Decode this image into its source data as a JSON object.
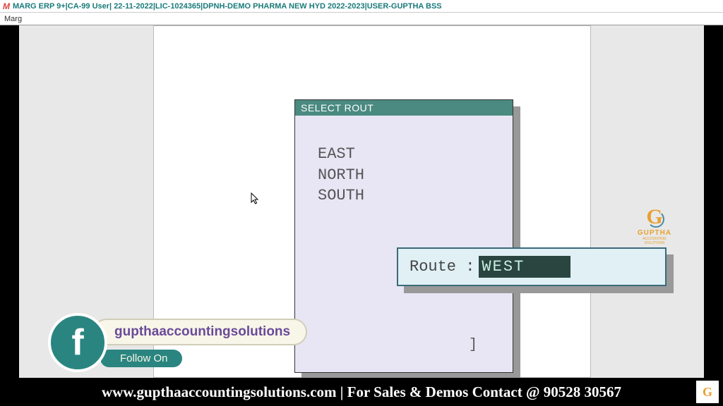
{
  "titlebar": {
    "text": "MARG ERP 9+|CA-99 User| 22-11-2022|LIC-1024365|DPNH-DEMO PHARMA NEW HYD 2022-2023|USER-GUPTHA BSS"
  },
  "menubar": {
    "item": "Marg"
  },
  "dialog": {
    "title": "SELECT ROUT",
    "items": [
      "EAST",
      "NORTH",
      "SOUTH"
    ],
    "closeBracket": "]"
  },
  "routeInput": {
    "label": "Route :",
    "value": "WEST"
  },
  "logo": {
    "letter": "G",
    "brand": "GUPTHA",
    "subtitle": "ACCOUNTING SOLUTIONS"
  },
  "facebook": {
    "letter": "f",
    "handle": "gupthaaccountingsolutions",
    "follow": "Follow On"
  },
  "banner": {
    "text": "www.gupthaaccountingsolutions.com | For Sales & Demos Contact @ 90528 30567"
  }
}
